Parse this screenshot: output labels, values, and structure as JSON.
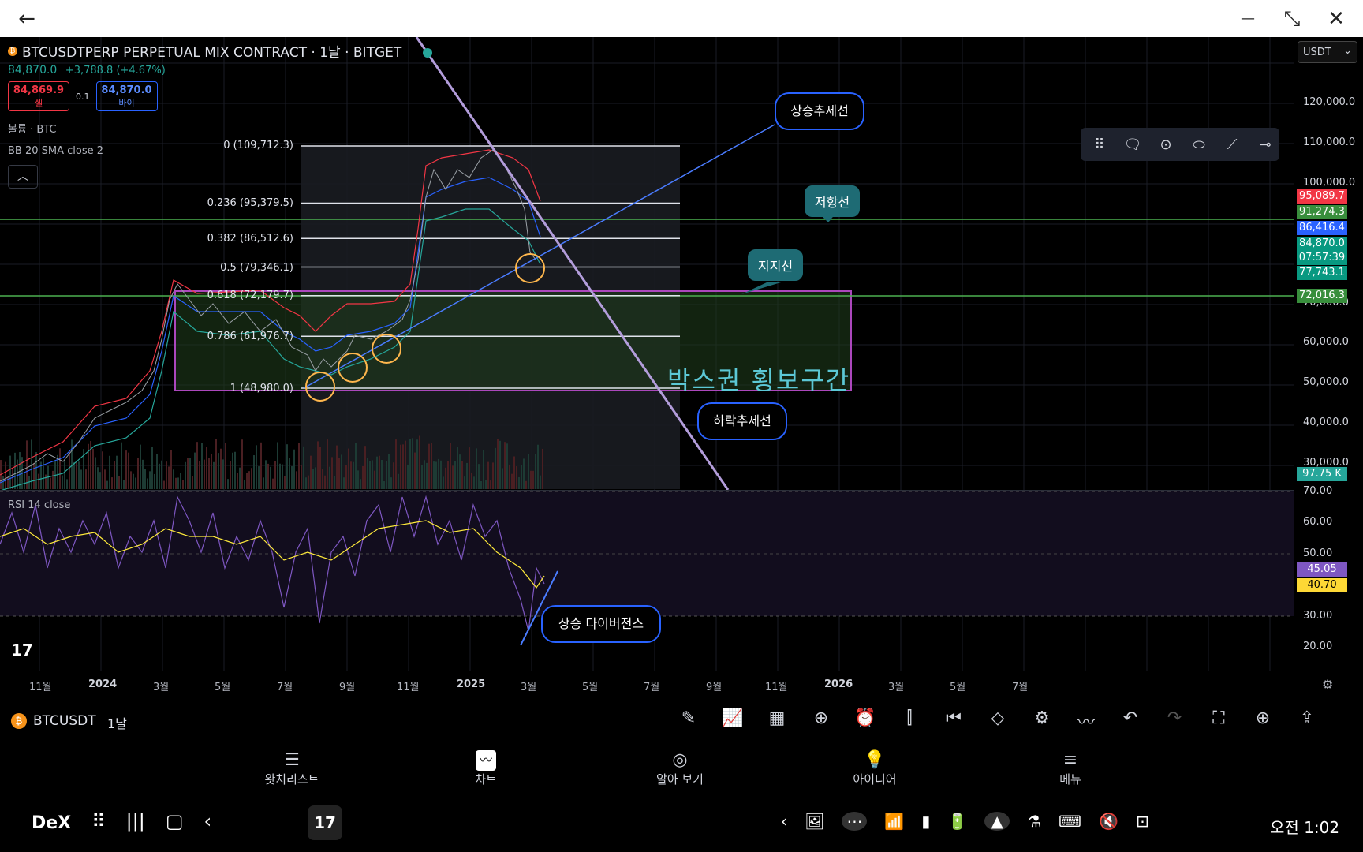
{
  "window": {
    "back_icon": "←",
    "minimize_icon": "—",
    "restore_icon": "⤡",
    "close_icon": "✕"
  },
  "legend": {
    "symbol_title": "BTCUSDTPERP PERPETUAL MIX CONTRACT · 1날 · BITGET",
    "coin_glyph": "₿",
    "last_price": "84,870.0",
    "change": "+3,788.8 (+4.67%)",
    "sell_price": "84,869.9",
    "sell_label": "셀",
    "spread": "0.1",
    "buy_price": "84,870.0",
    "buy_label": "바이",
    "volume_indicator": "볼륨 · BTC",
    "bb_indicator": "BB 20 SMA close 2",
    "collapse_icon": "︿"
  },
  "currency_select": {
    "value": "USDT",
    "chevron": "⌄"
  },
  "drawing_toolbar": [
    "⠿",
    "🗨",
    "⊙",
    "⬭",
    "⟋",
    "⊸"
  ],
  "price_axis": {
    "labels": [
      "120,000.0",
      "110,000.0",
      "100,000.0",
      "70,000.0",
      "60,000.0",
      "50,000.0",
      "40,000.0",
      "30,000.0"
    ],
    "tags": [
      {
        "text": "95,089.7",
        "color": "#f23645"
      },
      {
        "text": "91,274.3",
        "color": "#388e3c"
      },
      {
        "text": "86,416.4",
        "color": "#2962ff"
      },
      {
        "text": "84,870.0",
        "color": "#089981"
      },
      {
        "text": "07:57:39",
        "color": "#089981"
      },
      {
        "text": "77,743.1",
        "color": "#089981"
      },
      {
        "text": "72,016.3",
        "color": "#388e3c"
      },
      {
        "text": "97.75 K",
        "color": "#26a69a"
      }
    ]
  },
  "fib_levels": [
    {
      "label": "0 (109,712.3)",
      "value": 109712.3
    },
    {
      "label": "0.236 (95,379.5)",
      "value": 95379.5
    },
    {
      "label": "0.382 (86,512.6)",
      "value": 86512.6
    },
    {
      "label": "0.5 (79,346.1)",
      "value": 79346.1
    },
    {
      "label": "0.618 (72,179.7)",
      "value": 72179.7
    },
    {
      "label": "0.786 (61,976.7)",
      "value": 61976.7
    },
    {
      "label": "1 (48,980.0)",
      "value": 48980.0
    }
  ],
  "annotations": {
    "uptrend": "상승추세선",
    "resistance": "저항선",
    "support": "지지선",
    "box_range": "박스권  횡보구간",
    "downtrend": "하락추세선",
    "divergence": "상승 다이버전스"
  },
  "rsi": {
    "label": "RSI 14 close",
    "axis": [
      "70.00",
      "60.00",
      "50.00",
      "30.00",
      "20.00"
    ],
    "tag_rsi": "45.05",
    "tag_ma": "40.70"
  },
  "time_axis": [
    "11월",
    "2024",
    "3월",
    "5월",
    "7월",
    "9월",
    "11월",
    "2025",
    "3월",
    "5월",
    "7월",
    "9월",
    "11월",
    "2026",
    "3월",
    "5월",
    "7월"
  ],
  "tv_logo": "17",
  "settings_icon": "⚙",
  "toolbar": {
    "symbol": "BTCUSDT",
    "timeframe": "1날",
    "tools": [
      "✎",
      "📈",
      "▦",
      "⊕",
      "⏰",
      "⫿",
      "⏮",
      "◇",
      "⚙",
      "〰",
      "↶",
      "↷",
      "⛶",
      "⊕",
      "⇪"
    ]
  },
  "bottom_nav": [
    {
      "icon": "☰",
      "label": "왓치리스트"
    },
    {
      "icon": "〰",
      "label": "차트"
    },
    {
      "icon": "◎",
      "label": "알아 보기"
    },
    {
      "icon": "💡",
      "label": "아이디어"
    },
    {
      "icon": "≡",
      "label": "메뉴"
    }
  ],
  "dex_bar": {
    "dex_label": "DeX",
    "nav_icons": [
      "⠿",
      "|||",
      "▢",
      "‹"
    ],
    "tv_logo": "17",
    "sys_icons": [
      "‹",
      "🖼",
      "⋯",
      "📶",
      "▮",
      "🔋",
      "▲",
      "⚗",
      "⌨",
      "🔇",
      "⊡"
    ],
    "clock": "오전 1:02"
  }
}
